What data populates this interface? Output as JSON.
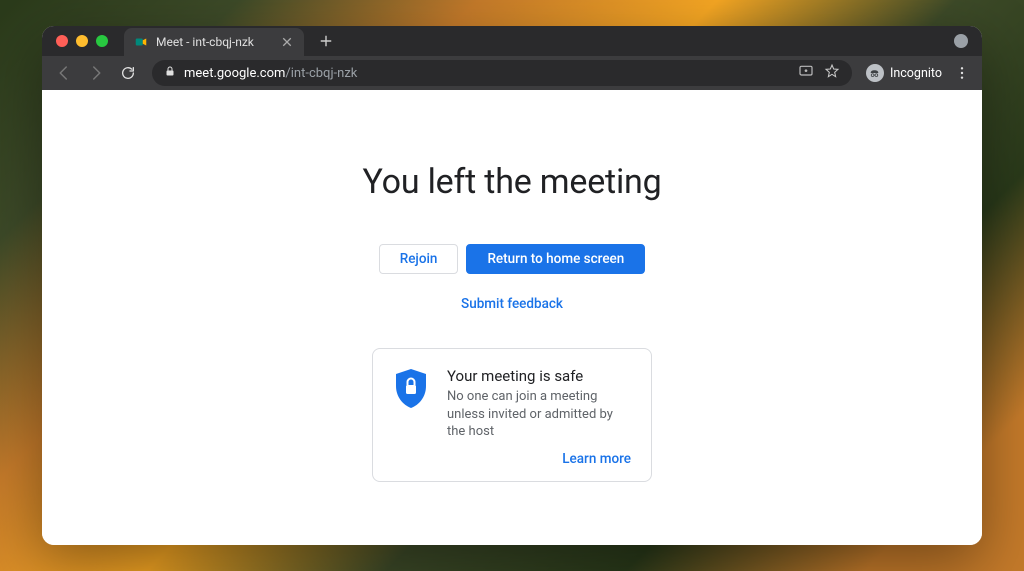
{
  "tab": {
    "title": "Meet - int-cbqj-nzk"
  },
  "address": {
    "domain": "meet.google.com",
    "path": "/int-cbqj-nzk"
  },
  "incognito_label": "Incognito",
  "page": {
    "headline": "You left the meeting",
    "rejoin_label": "Rejoin",
    "return_label": "Return to home screen",
    "feedback_label": "Submit feedback",
    "safe": {
      "title": "Your meeting is safe",
      "desc": "No one can join a meeting unless invited or admitted by the host",
      "learn_more": "Learn more"
    }
  }
}
